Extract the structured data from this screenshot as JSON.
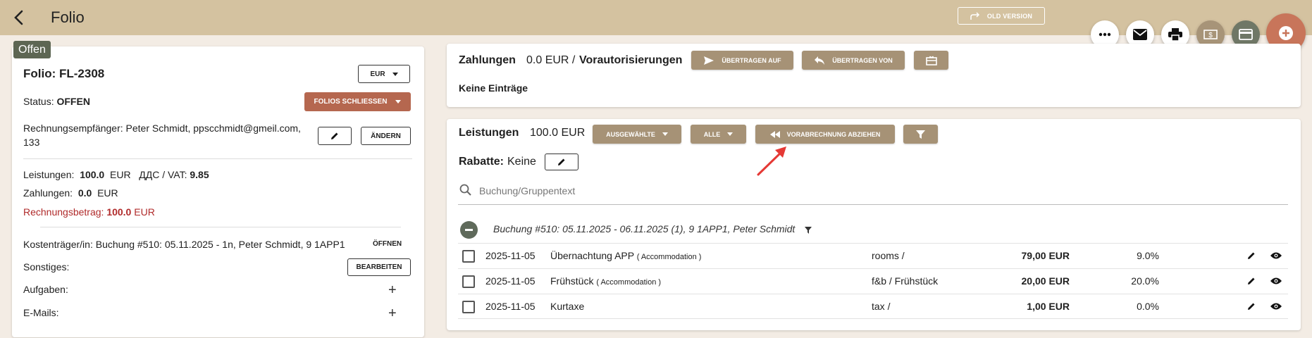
{
  "app": {
    "title": "Folio",
    "old_version_label": "OLD VERSION"
  },
  "fabs": [
    "more-horizontal-icon",
    "mail-icon",
    "print-icon",
    "money-icon",
    "credit-card-icon",
    "add-circle-icon"
  ],
  "left": {
    "status_tab": "Offen",
    "folio_title": "Folio: FL-2308",
    "currency": "EUR",
    "status_label": "Status:",
    "status_value": "OFFEN",
    "close_button": "FOLIOS SCHLIESSEN",
    "recipient_label": "Rechnungsempfänger:",
    "recipient_value_line1": "Peter Schmidt, ppscchmidt@gmeil.com,",
    "recipient_value_line2": "133",
    "change_button": "ÄNDERN",
    "services_label": "Leistungen:",
    "services_value": "100.0",
    "services_currency": "EUR",
    "vat_label": "ДДС / VAT:",
    "vat_value": "9.85",
    "payments_label": "Zahlungen:",
    "payments_value": "0.0",
    "payments_currency": "EUR",
    "invoice_label": "Rechnungsbetrag:",
    "invoice_value": "100.0",
    "invoice_currency": "EUR",
    "payer_label": "Kostenträger/in:",
    "payer_value": "Buchung #510: 05.11.2025 - 1n, Peter Schmidt, 9 1APP1",
    "open_button": "ÖFFNEN",
    "misc_label": "Sonstiges:",
    "edit_button": "BEARBEITEN",
    "tasks_label": "Aufgaben:",
    "emails_label": "E-Mails:"
  },
  "payments": {
    "title": "Zahlungen",
    "amount": "0.0 EUR /",
    "preauth": "Vorautorisierungen",
    "transfer_to": "ÜBERTRAGEN AUF",
    "transfer_from": "ÜBERTRAGEN VON",
    "empty": "Keine Einträge"
  },
  "services": {
    "title": "Leistungen",
    "amount": "100.0 EUR",
    "selected_button": "AUSGEWÄHLTE",
    "all_button": "ALLE",
    "prepay_button": "VORABRECHNUNG ABZIEHEN",
    "discounts_label": "Rabatte:",
    "discounts_value": "Keine",
    "search_placeholder": "Buchung/Gruppentext",
    "group_text": "Buchung #510: 05.11.2025 - 06.11.2025 (1), 9 1APP1, Peter Schmidt",
    "rows": [
      {
        "date": "2025-11-05",
        "name": "Übernachtung APP",
        "type": "( Accommodation )",
        "account": "rooms /",
        "amount": "79,00 EUR",
        "vat": "9.0%"
      },
      {
        "date": "2025-11-05",
        "name": "Frühstück",
        "type": "( Accommodation )",
        "account": "f&b / Frühstück",
        "amount": "20,00 EUR",
        "vat": "20.0%"
      },
      {
        "date": "2025-11-05",
        "name": "Kurtaxe",
        "type": "",
        "account": "tax /",
        "amount": "1,00 EUR",
        "vat": "0.0%"
      }
    ]
  },
  "colors": {
    "topbar": "#d4c2a0",
    "tan_button": "#a69276",
    "brown_button": "#b5674f",
    "status_green": "#5d6653",
    "invoice_red": "#b02a2a",
    "arrow_red": "#e53935"
  }
}
